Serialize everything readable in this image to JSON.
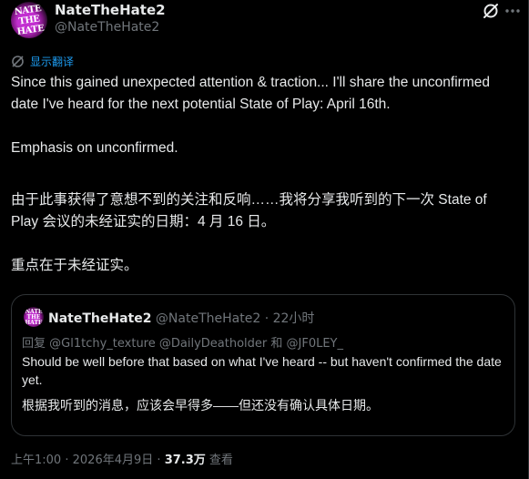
{
  "author": {
    "display_name": "NateTheHate2",
    "handle": "@NateTheHate2",
    "avatar_text": "NATE THE HATE"
  },
  "header_icons": {
    "grok": "grok-icon",
    "more": "more-icon"
  },
  "translate": {
    "label": "显示翻译",
    "icon": "translate-icon"
  },
  "tweet": {
    "text": "Since this gained unexpected attention & traction... I'll share the unconfirmed date I've heard for the next potential State of Play: April 16th.\n\nEmphasis on unconfirmed.",
    "translated": "由于此事获得了意想不到的关注和反响……我将分享我听到的下一次 State of Play 会议的未经证实的日期：4 月 16 日。\n\n重点在于未经证实。"
  },
  "quote": {
    "display_name": "NateTheHate2",
    "handle": "@NateTheHate2",
    "time": "22小时",
    "separator": "·",
    "reply_label": "回复",
    "reply_to": "@Gl1tchy_texture @DailyDeatholder 和 @JF0LEY_",
    "text": "Should be well before that based on what I've heard -- but haven't confirmed the date yet.",
    "translated": "根据我听到的消息，应该会早得多——但还没有确认具体日期。"
  },
  "footer": {
    "time": "上午1:00",
    "date": "2026年4月9日",
    "separator": "·",
    "views_count": "37.3万",
    "views_label": "查看"
  }
}
